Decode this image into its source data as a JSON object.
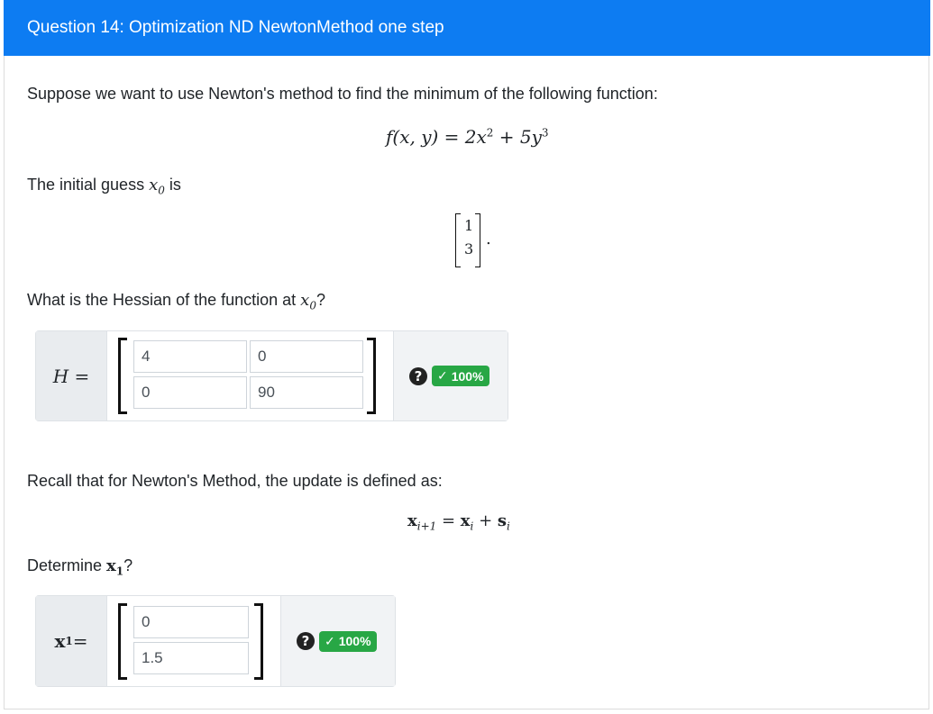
{
  "header": {
    "title": "Question 14: Optimization ND NewtonMethod one step"
  },
  "intro": {
    "text": "Suppose we want to use Newton's method to find the minimum of the following function:"
  },
  "function_eq": {
    "lhs": "f(x, y) = 2x",
    "exp1": "2",
    "mid": " + 5y",
    "exp2": "3"
  },
  "initial": {
    "text": "The initial guess ",
    "var": "x",
    "sub": "0",
    "suffix": " is"
  },
  "x0_vector": {
    "values": [
      "1",
      "3"
    ],
    "trailing": "."
  },
  "hessian_question": {
    "text": "What is the Hessian of the function at ",
    "var": "x",
    "sub": "0",
    "suffix": "?"
  },
  "hessian": {
    "label": "H =",
    "cells": [
      "4",
      "0",
      "0",
      "90"
    ],
    "help": "?",
    "badge": "100%",
    "badge_check": "✓"
  },
  "recall": {
    "text": "Recall that for Newton's Method, the update is defined as:"
  },
  "update_eq": {
    "x": "x",
    "sub_i1": "i+1",
    "eq": " = ",
    "x2": "x",
    "sub_i": "i",
    "plus": " + ",
    "s": "s",
    "sub_i2": "i"
  },
  "determine": {
    "text": "Determine ",
    "var": "x",
    "sub": "1",
    "suffix": "?"
  },
  "x1": {
    "label_var": "x",
    "label_sub": "1",
    "label_eq": " =",
    "cells": [
      "0",
      "1.5"
    ],
    "help": "?",
    "badge": "100%",
    "badge_check": "✓"
  }
}
